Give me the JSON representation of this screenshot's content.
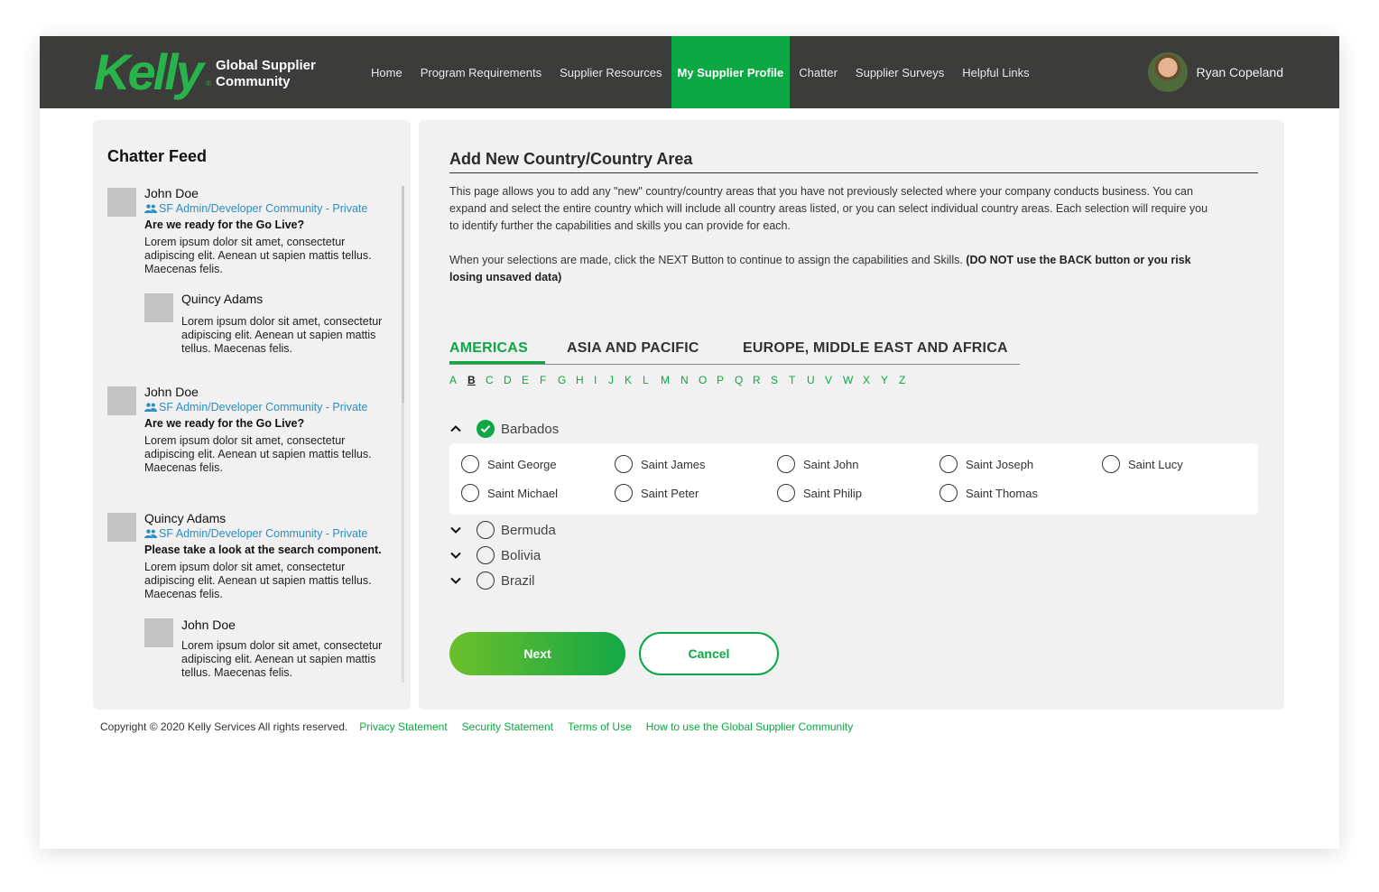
{
  "brand": {
    "logo_text": "Kelly",
    "title": "Global Supplier Community"
  },
  "nav": [
    {
      "label": "Home",
      "active": false
    },
    {
      "label": "Program Requirements",
      "active": false
    },
    {
      "label": "Supplier Resources",
      "active": false
    },
    {
      "label": "My Supplier Profile",
      "active": true
    },
    {
      "label": "Chatter",
      "active": false
    },
    {
      "label": "Supplier Surveys",
      "active": false
    },
    {
      "label": "Helpful Links",
      "active": false
    }
  ],
  "user": {
    "name": "Ryan Copeland"
  },
  "chatter": {
    "title": "Chatter Feed",
    "posts": [
      {
        "name": "John Doe",
        "group": "SF Admin/Developer Community - Private",
        "subject": "Are we ready for the Go Live?",
        "body": "Lorem ipsum dolor sit amet, consectetur adipiscing elit. Aenean ut sapien mattis tellus. Maecenas felis.",
        "reply": {
          "name": "Quincy Adams",
          "body": "Lorem ipsum dolor sit amet, consectetur adipiscing elit. Aenean ut sapien mattis tellus. Maecenas felis."
        }
      },
      {
        "name": "John Doe",
        "group": "SF Admin/Developer Community - Private",
        "subject": "Are we ready for the Go Live?",
        "body": "Lorem ipsum dolor sit amet, consectetur adipiscing elit. Aenean ut sapien mattis tellus. Maecenas felis."
      },
      {
        "name": "Quincy Adams",
        "group": "SF Admin/Developer Community - Private",
        "subject": "Please take a look at the search component.",
        "body": "Lorem ipsum dolor sit amet, consectetur adipiscing elit. Aenean ut sapien mattis tellus. Maecenas felis.",
        "reply": {
          "name": "John Doe",
          "body": "Lorem ipsum dolor sit amet, consectetur adipiscing elit. Aenean ut sapien mattis tellus. Maecenas felis."
        }
      }
    ]
  },
  "main": {
    "title": "Add New Country/Country Area",
    "intro": "This page allows you to add any \"new\" country/country areas that you have not previously selected where your company conducts business. You can expand and select the entire country which will include all country areas listed, or you can select individual country areas. Each selection will require you to identify further the capabilities and skills you can provide for each.",
    "intro2_plain": "When your selections are made, click the NEXT Button to continue to assign the capabilities and Skills. ",
    "intro2_bold": "(DO NOT use the BACK button or you risk losing unsaved data)",
    "tabs": [
      "AMERICAS",
      "ASIA AND PACIFIC",
      "EUROPE, MIDDLE EAST AND AFRICA"
    ],
    "active_tab": "AMERICAS",
    "letters": [
      "A",
      "B",
      "C",
      "D",
      "E",
      "F",
      "G",
      "H",
      "I",
      "J",
      "K",
      "L",
      "M",
      "N",
      "O",
      "P",
      "Q",
      "R",
      "S",
      "T",
      "U",
      "V",
      "W",
      "X",
      "Y",
      "Z"
    ],
    "selected_letter": "B",
    "countries": [
      {
        "name": "Barbados",
        "expanded": true,
        "checked": true
      },
      {
        "name": "Bermuda",
        "expanded": false,
        "checked": false
      },
      {
        "name": "Bolivia",
        "expanded": false,
        "checked": false
      },
      {
        "name": "Brazil",
        "expanded": false,
        "checked": false
      }
    ],
    "areas": [
      "Saint George",
      "Saint James",
      "Saint John",
      "Saint Joseph",
      "Saint Lucy",
      "Saint Michael",
      "Saint Peter",
      "Saint Philip",
      "Saint Thomas"
    ],
    "next_label": "Next",
    "cancel_label": "Cancel"
  },
  "footer": {
    "copyright": "Copyright © 2020 Kelly Services All rights reserved.",
    "links": [
      "Privacy Statement",
      "Security Statement",
      "Terms of Use",
      "How to use the Global Supplier Community"
    ]
  },
  "colors": {
    "accent": "#0ba843",
    "header_bg": "#3c3c3b",
    "link_blue": "#2b8ec2"
  }
}
